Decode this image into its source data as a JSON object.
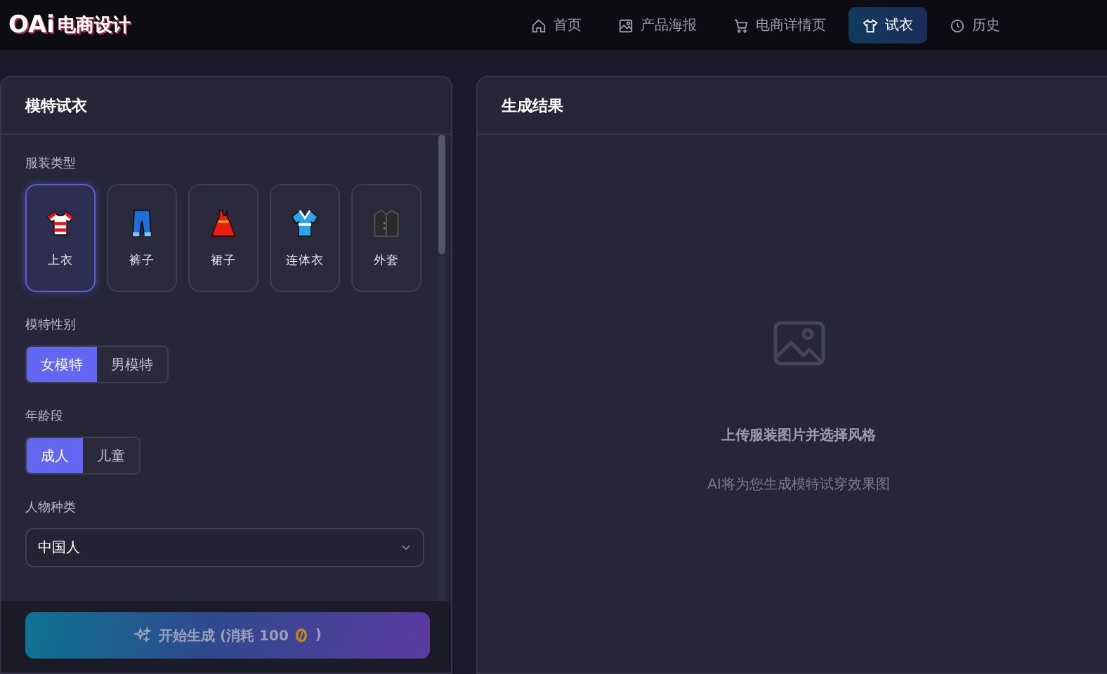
{
  "header": {
    "logo_mark": "OAi",
    "logo_text": "电商设计",
    "nav": [
      {
        "label": "首页",
        "kind": "home",
        "selected": false
      },
      {
        "label": "产品海报",
        "kind": "image",
        "selected": false
      },
      {
        "label": "电商详情页",
        "kind": "cart",
        "selected": false
      },
      {
        "label": "试衣",
        "kind": "shirt",
        "selected": true
      },
      {
        "label": "历史",
        "kind": "clock",
        "selected": false
      }
    ]
  },
  "left_panel": {
    "title": "模特试衣",
    "garment_section": {
      "label": "服装类型",
      "items": [
        {
          "label": "上衣",
          "kind": "shirt",
          "selected": true
        },
        {
          "label": "裤子",
          "kind": "pants",
          "selected": false
        },
        {
          "label": "裙子",
          "kind": "dress",
          "selected": false
        },
        {
          "label": "连体衣",
          "kind": "kimono",
          "selected": false
        },
        {
          "label": "外套",
          "kind": "coat",
          "selected": false
        }
      ]
    },
    "gender_section": {
      "label": "模特性别",
      "options": [
        {
          "label": "女模特",
          "selected": true
        },
        {
          "label": "男模特",
          "selected": false
        }
      ]
    },
    "age_section": {
      "label": "年龄段",
      "options": [
        {
          "label": "成人",
          "selected": true
        },
        {
          "label": "儿童",
          "selected": false
        }
      ]
    },
    "ethnicity_section": {
      "label": "人物种类",
      "value": "中国人"
    },
    "generate_button": {
      "label": "开始生成 (消耗 100",
      "suffix": ")"
    }
  },
  "right_panel": {
    "title": "生成结果",
    "empty_title": "上传服装图片并选择风格",
    "empty_hint": "AI将为您生成模特试穿效果图"
  }
}
